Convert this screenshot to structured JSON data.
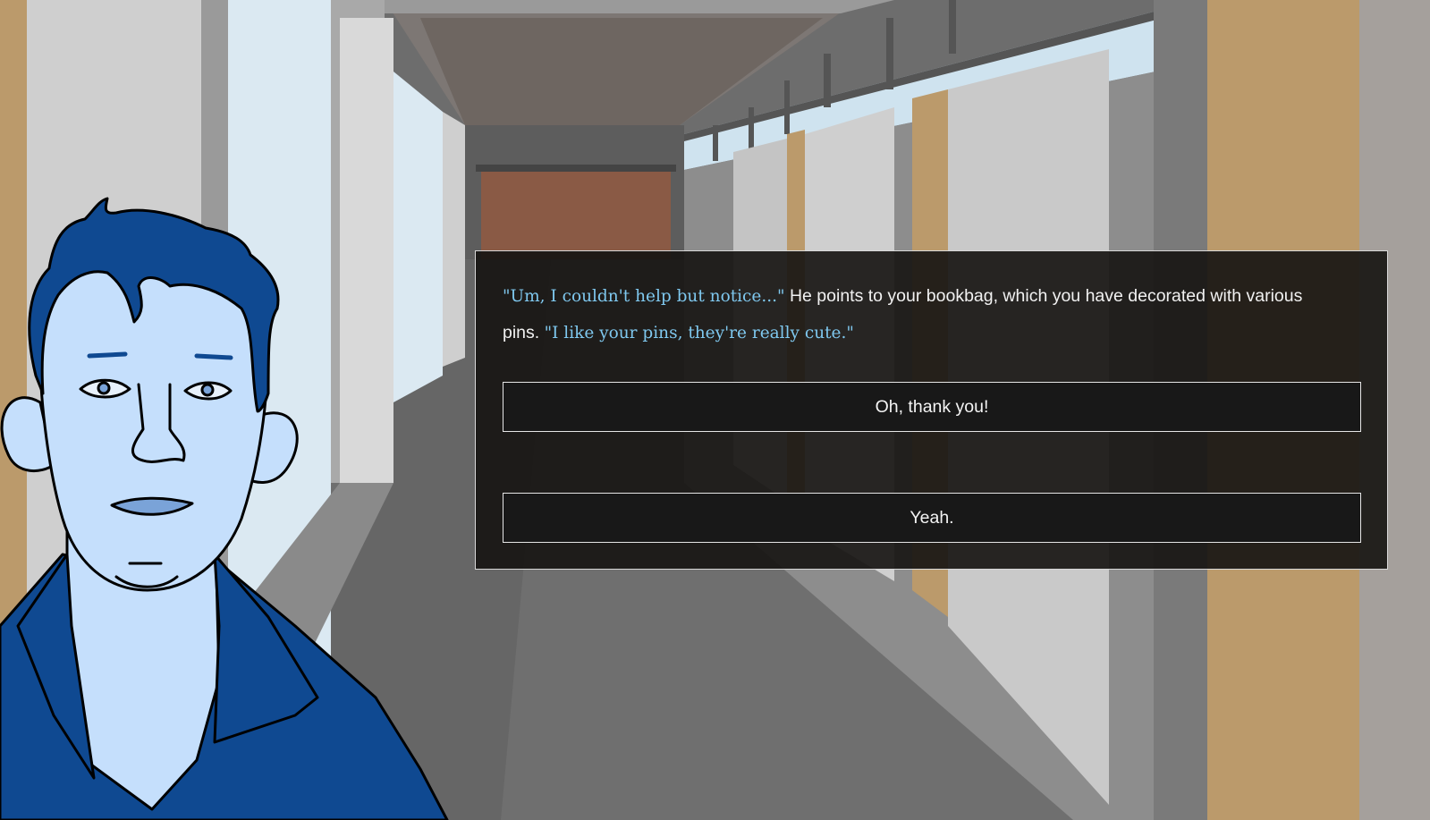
{
  "dialog": {
    "speech_1": "\"Um, I couldn't help but notice...\"",
    "narration": " He points to your bookbag, which you have decorated with various pins. ",
    "speech_2": "\"I like your pins, they're really cute.\""
  },
  "choices": [
    {
      "label": "Oh, thank you!"
    },
    {
      "label": "Yeah."
    }
  ],
  "colors": {
    "speech_text": "#7fc8ef",
    "narration_text": "#f1f1f1",
    "character_skin": "#c5dffc",
    "character_hair_shirt": "#0f4991",
    "door_wood": "#bb9a6b"
  }
}
